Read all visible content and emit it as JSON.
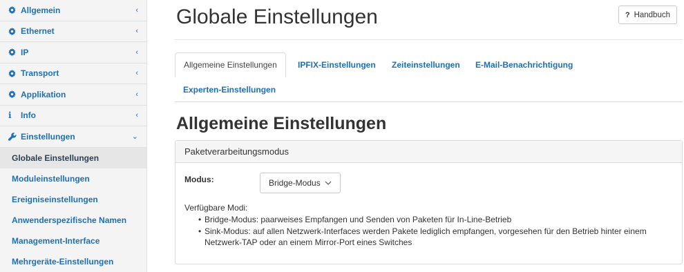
{
  "sidebar": {
    "items": [
      {
        "label": "Allgemein",
        "icon": "gear-icon"
      },
      {
        "label": "Ethernet",
        "icon": "gear-icon"
      },
      {
        "label": "IP",
        "icon": "gear-icon"
      },
      {
        "label": "Transport",
        "icon": "gear-icon"
      },
      {
        "label": "Applikation",
        "icon": "gear-icon"
      },
      {
        "label": "Info",
        "icon": "info-icon"
      },
      {
        "label": "Einstellungen",
        "icon": "wrench-icon"
      }
    ],
    "collapsed_chevron": "‹",
    "open_chevron": "⌄",
    "sub_items": [
      {
        "label": "Globale Einstellungen",
        "active": true
      },
      {
        "label": "Moduleinstellungen"
      },
      {
        "label": "Ereigniseinstellungen"
      },
      {
        "label": "Anwenderspezifische Namen"
      },
      {
        "label": "Management-Interface"
      },
      {
        "label": "Mehrgeräte-Einstellungen"
      }
    ]
  },
  "header": {
    "title": "Globale Einstellungen",
    "help_icon": "?",
    "help_label": "Handbuch"
  },
  "tabs": [
    {
      "label": "Allgemeine Einstellungen",
      "active": true
    },
    {
      "label": "IPFIX-Einstellungen"
    },
    {
      "label": "Zeiteinstellungen"
    },
    {
      "label": "E-Mail-Benachrichtigung"
    },
    {
      "label": "Experten-Einstellungen"
    }
  ],
  "section": {
    "title": "Allgemeine Einstellungen",
    "panel_title": "Paketverarbeitungsmodus",
    "mode_label": "Modus:",
    "mode_value": "Bridge-Modus",
    "available_label": "Verfügbare Modi:",
    "modes": [
      "Bridge-Modus: paarweises Empfangen und Senden von Paketen für In-Line-Betrieb",
      "Sink-Modus: auf allen Netzwerk-Interfaces werden Pakete lediglich empfangen, vorgesehen für den Betrieb hinter einem Netzwerk-TAP oder an einem Mirror-Port eines Switches"
    ]
  },
  "colors": {
    "link": "#1f6fb5",
    "sidebar_bg": "#f4f4f4",
    "active_bg": "#e6e6e6"
  }
}
